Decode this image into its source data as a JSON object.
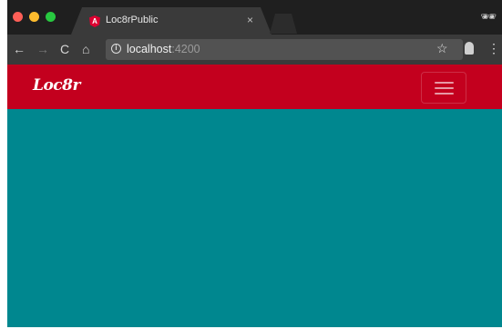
{
  "browser": {
    "tab": {
      "title": "Loc8rPublic",
      "favicon_letter": "A",
      "close_glyph": "×"
    },
    "toolbar": {
      "back_glyph": "←",
      "forward_glyph": "→",
      "reload_glyph": "C",
      "home_glyph": "⌂",
      "info_glyph": "i",
      "url_host": "localhost",
      "url_port": ":4200",
      "bookmark_glyph": "☆",
      "menu_glyph": "⋮"
    },
    "incognito_glyph": "🕶"
  },
  "app": {
    "brand": "Loc8r",
    "colors": {
      "navbar": "#c3001e",
      "background": "#00878f"
    }
  }
}
